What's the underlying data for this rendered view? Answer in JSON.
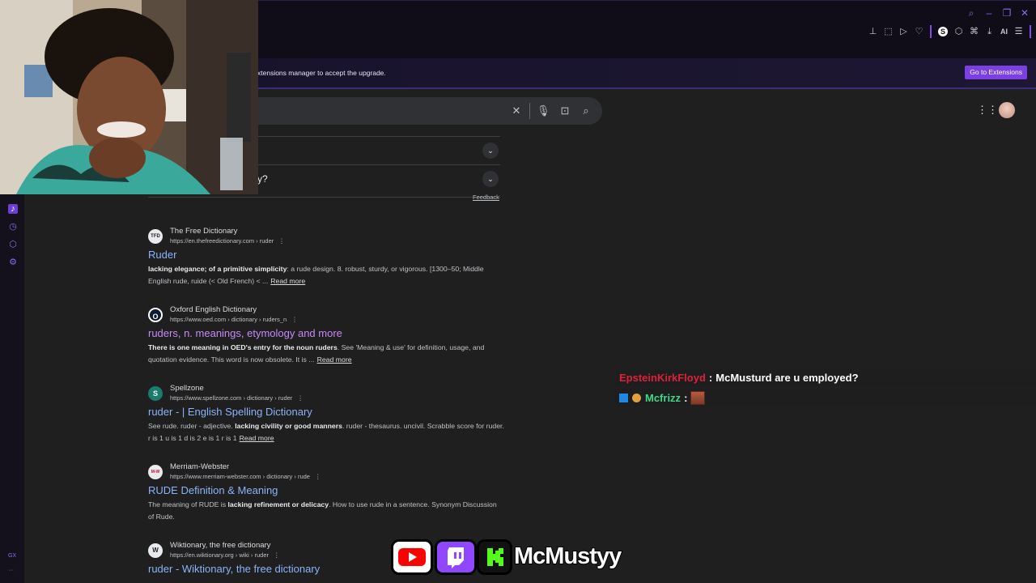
{
  "titlebar": {
    "window_controls": [
      "search-icon",
      "minimize-icon",
      "restore-icon",
      "close-icon"
    ],
    "toolbar_icons": [
      "pin-icon",
      "screenshot-icon",
      "play-icon",
      "heart-icon",
      "extension-s-icon",
      "cube-icon",
      "puzzle-icon",
      "download-icon"
    ],
    "ai_label": "AI",
    "extension_s_letter": "S"
  },
  "banner": {
    "text": "xtensions manager to accept the upgrade.",
    "button_label": "Go to Extensions"
  },
  "search": {
    "icons": [
      "clear-icon",
      "mic-icon",
      "lens-icon",
      "search-icon"
    ]
  },
  "faq": [
    {
      "text": "",
      "chevron": "⌄"
    },
    {
      "text": "y?",
      "chevron": "⌄"
    }
  ],
  "feedback_label": "Feedback",
  "results": [
    {
      "site": "The Free Dictionary",
      "url": "https://en.thefreedictionary.com › ruder",
      "title": "Ruder",
      "visited": false,
      "favicon": "TFD",
      "snippet_bold": "lacking elegance; of a primitive simplicity",
      "snippet": ": a rude design. 8. robust, sturdy, or vigorous. [1300–50; Middle English rude, ruide (< Old French) < ...",
      "snippet_tail": "",
      "read_more": "Read more"
    },
    {
      "site": "Oxford English Dictionary",
      "url": "https://www.oed.com › dictionary › ruders_n",
      "title": "ruders, n. meanings, etymology and more",
      "visited": true,
      "favicon": "O",
      "snippet_bold": "There is one meaning in OED's entry for the noun ruders",
      "snippet": ". See 'Meaning & use' for definition, usage, and quotation evidence. This word is now obsolete. It is ...",
      "snippet_tail": "",
      "read_more": "Read more"
    },
    {
      "site": "Spellzone",
      "url": "https://www.spellzone.com › dictionary › ruder",
      "title": "ruder - | English Spelling Dictionary",
      "visited": false,
      "favicon": "S",
      "snippet_pre": "See rude. ruder - adjective. ",
      "snippet_bold": "lacking civility or good manners",
      "snippet": ". ruder - thesaurus. uncivil. Scrabble score for ruder. r is 1 u is 1 d is 2 e is 1 r is 1",
      "read_more": "Read more"
    },
    {
      "site": "Merriam-Webster",
      "url": "https://www.merriam-webster.com › dictionary › rude",
      "title": "RUDE Definition & Meaning",
      "visited": false,
      "favicon": "M-W",
      "snippet_pre": "The meaning of RUDE is ",
      "snippet_bold": "lacking refinement or delicacy",
      "snippet": ". How to use rude in a sentence. Synonym Discussion of Rude.",
      "read_more": ""
    },
    {
      "site": "Wiktionary, the free dictionary",
      "url": "https://en.wiktionary.org › wiki › ruder",
      "title": "ruder - Wiktionary, the free dictionary",
      "visited": false,
      "favicon": "W"
    }
  ],
  "chat": [
    {
      "user": "EpsteinKirkFloyd",
      "user_color": "#e0203a",
      "text": "McMusturd are u employed?"
    },
    {
      "user": "Mcfrizz",
      "user_color": "#3dd88a",
      "text": ""
    }
  ],
  "socials": {
    "name": "McMustyy"
  },
  "sidebar": {
    "bottom_label": "GX",
    "more": "···"
  },
  "colors": {
    "accent": "#7b3fe4",
    "link": "#8ab4f8",
    "visited": "#c58af9"
  }
}
